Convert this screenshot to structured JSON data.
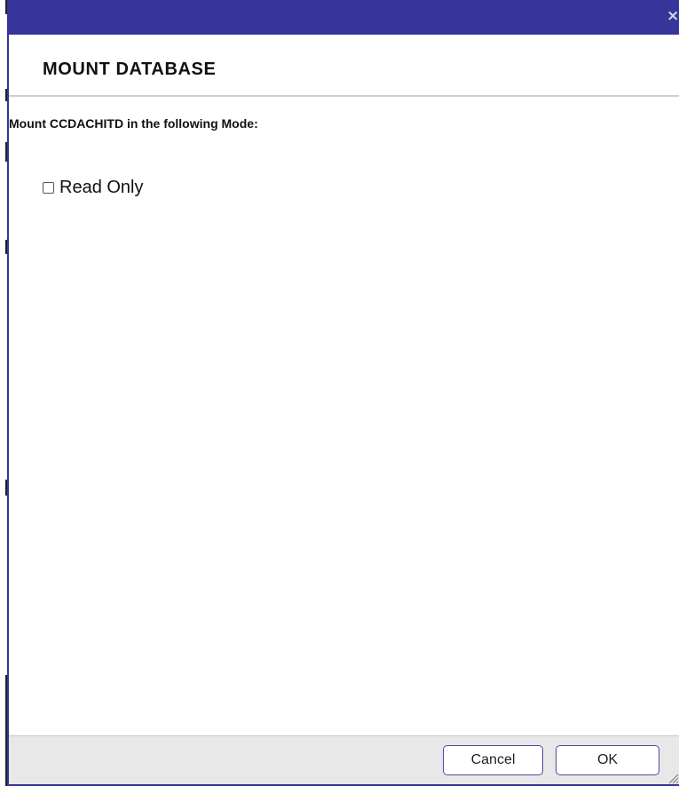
{
  "dialog": {
    "close_symbol": "×",
    "title": "MOUNT DATABASE",
    "prompt": "Mount CCDACHITD in the following Mode:",
    "options": [
      {
        "label": "Read Only",
        "checked": false
      }
    ]
  },
  "footer": {
    "cancel_label": "Cancel",
    "ok_label": "OK"
  },
  "colors": {
    "dialog_frame": "#35359a",
    "footer_bg": "#e8e8e8",
    "button_border": "#4a4aa8"
  }
}
